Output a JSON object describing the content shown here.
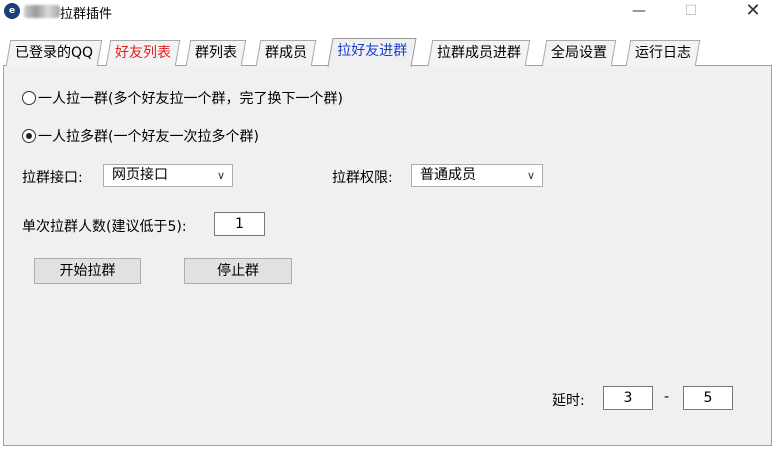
{
  "window": {
    "title": "拉群插件",
    "icon": "app-e-icon",
    "minimize": "—",
    "maximize": "☐",
    "close": "✕"
  },
  "tabs": [
    {
      "label": "已登录的QQ",
      "color": "#000000"
    },
    {
      "label": "好友列表",
      "color": "#e02020"
    },
    {
      "label": "群列表",
      "color": "#000000"
    },
    {
      "label": "群成员",
      "color": "#000000"
    },
    {
      "label": "拉好友进群",
      "color": "#1a3fd1",
      "active": true
    },
    {
      "label": "拉群成员进群",
      "color": "#000000"
    },
    {
      "label": "全局设置",
      "color": "#000000"
    },
    {
      "label": "运行日志",
      "color": "#000000"
    }
  ],
  "mode": {
    "one_to_one": "一人拉一群(多个好友拉一个群，完了换下一个群)",
    "one_to_many": "一人拉多群(一个好友一次拉多个群)",
    "selected": "one_to_many"
  },
  "interface": {
    "label": "拉群接口:",
    "value": "网页接口"
  },
  "permission": {
    "label": "拉群权限:",
    "value": "普通成员"
  },
  "batch": {
    "label": "单次拉群人数(建议低于5):",
    "value": "1"
  },
  "buttons": {
    "start": "开始拉群",
    "stop": "停止群"
  },
  "delay": {
    "label": "延时:",
    "min": "3",
    "separator": "-",
    "max": "5"
  }
}
